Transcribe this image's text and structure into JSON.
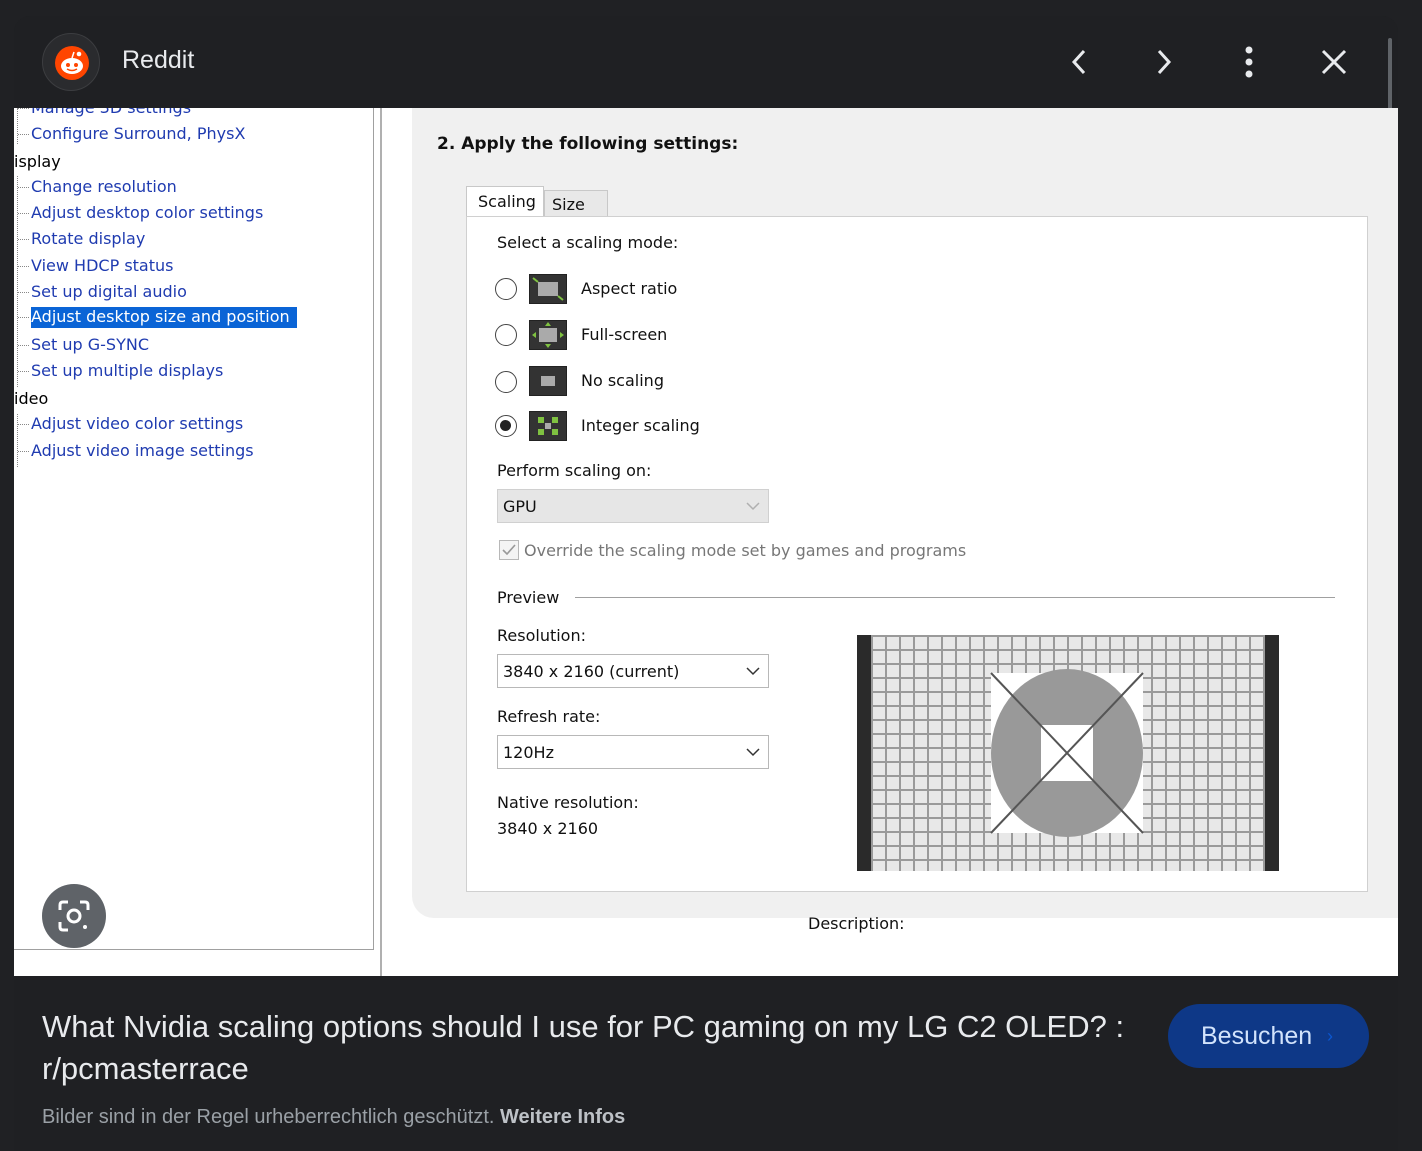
{
  "header": {
    "site_name": "Reddit",
    "icons": {
      "back": "chevron-left-icon",
      "forward": "chevron-right-icon",
      "more": "more-vert-icon",
      "close": "close-icon"
    }
  },
  "screenshot": {
    "tree": {
      "partial_top_item": "Manage 3D settings",
      "items": [
        {
          "text": "Configure Surround, PhysX",
          "kind": "item"
        },
        {
          "text": "isplay",
          "kind": "category"
        },
        {
          "text": "Change resolution",
          "kind": "item"
        },
        {
          "text": "Adjust desktop color settings",
          "kind": "item"
        },
        {
          "text": "Rotate display",
          "kind": "item"
        },
        {
          "text": "View HDCP status",
          "kind": "item"
        },
        {
          "text": "Set up digital audio",
          "kind": "item"
        },
        {
          "text": "Adjust desktop size and position",
          "kind": "item",
          "selected": true
        },
        {
          "text": "Set up G-SYNC",
          "kind": "item"
        },
        {
          "text": "Set up multiple displays",
          "kind": "item"
        },
        {
          "text": "ideo",
          "kind": "category"
        },
        {
          "text": "Adjust video color settings",
          "kind": "item"
        },
        {
          "text": "Adjust video image settings",
          "kind": "item"
        }
      ]
    },
    "settings": {
      "heading": "2. Apply the following settings:",
      "tabs": [
        "Scaling",
        "Size"
      ],
      "scaling_mode_label": "Select a scaling mode:",
      "modes": [
        {
          "label": "Aspect ratio",
          "checked": false,
          "icon": "aspect-ratio-icon"
        },
        {
          "label": "Full-screen",
          "checked": false,
          "icon": "full-screen-icon"
        },
        {
          "label": "No scaling",
          "checked": false,
          "icon": "no-scaling-icon"
        },
        {
          "label": "Integer scaling",
          "checked": true,
          "icon": "integer-scaling-icon"
        }
      ],
      "perform_label": "Perform scaling on:",
      "perform_value": "GPU",
      "override_label": "Override the scaling mode set by games and programs",
      "override_checked": true,
      "preview_label": "Preview",
      "resolution_label": "Resolution:",
      "resolution_value": "3840 x 2160 (current)",
      "refresh_label": "Refresh rate:",
      "refresh_value": "120Hz",
      "native_label": "Native resolution:",
      "native_value": "3840 x 2160",
      "description_label": "Description:"
    }
  },
  "footer": {
    "title": "What Nvidia scaling options should I use for PC gaming on my LG C2 OLED? : r/pcmasterrace",
    "visit_label": "Besuchen",
    "copyright_text": "Bilder sind in der Regel urheberrechtlich geschützt.",
    "more_info": "Weitere Infos"
  }
}
